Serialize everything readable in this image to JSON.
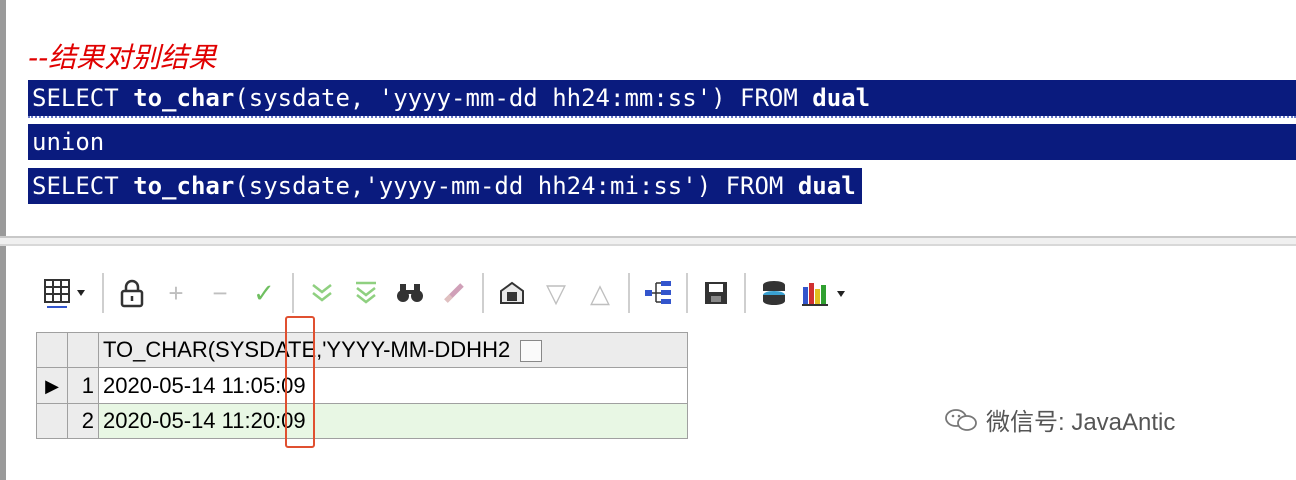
{
  "editor": {
    "comment": "--结果对别结果",
    "lines": [
      {
        "p1": "SELECT ",
        "fn": "to_char",
        "p2": "(sysdate, 'yyyy-mm-dd hh24:mm:ss') FROM ",
        "kw": "dual"
      },
      {
        "text": "union"
      },
      {
        "p1": "SELECT ",
        "fn": "to_char",
        "p2": "(sysdate,'yyyy-mm-dd hh24:mi:ss') FROM ",
        "kw": "dual"
      }
    ]
  },
  "toolbar": {
    "icons": [
      "grid-icon",
      "lock-icon",
      "plus-icon",
      "minus-icon",
      "check-icon",
      "double-arrow-down-icon",
      "filter-icon",
      "binoculars-icon",
      "clear-icon",
      "export-icon",
      "triangle-down-icon",
      "triangle-up-icon",
      "tree-icon",
      "save-icon",
      "stack-icon",
      "bar-chart-icon"
    ]
  },
  "grid": {
    "column_header": "TO_CHAR(SYSDATE,'YYYY-MM-DDHH2",
    "rows": [
      {
        "num": "1",
        "value": "2020-05-14 11:05:09",
        "current": true
      },
      {
        "num": "2",
        "value": "2020-05-14 11:20:09",
        "current": false
      }
    ]
  },
  "watermark": {
    "label": "微信号: JavaAntic"
  },
  "colors": {
    "selection_bg": "#0a1b7e",
    "comment": "#e00000",
    "row_highlight": "#e8f7e4",
    "annotation_box": "#e05030"
  }
}
